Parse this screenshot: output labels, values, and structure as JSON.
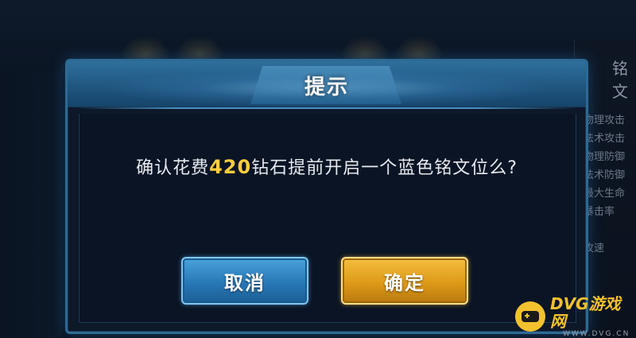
{
  "background": {
    "right_panel_title": "铭文",
    "right_panel_items": [
      "物理攻击",
      "法术攻击",
      "物理防御",
      "法术防御",
      "最大生命",
      "暴击率",
      "",
      "攻速"
    ]
  },
  "dialog": {
    "title": "提示",
    "message_prefix": "确认花费",
    "message_cost": "420",
    "message_suffix": "钻石提前开启一个蓝色铭文位么?",
    "cancel_label": "取消",
    "confirm_label": "确定"
  },
  "watermark": {
    "name": "DVG游戏网",
    "url": "WWW.DVG.CN"
  },
  "colors": {
    "cost_highlight": "#ffce3a",
    "cancel_button": "#2778b6",
    "confirm_button": "#dd9a18",
    "dialog_border": "#2d6a93"
  }
}
